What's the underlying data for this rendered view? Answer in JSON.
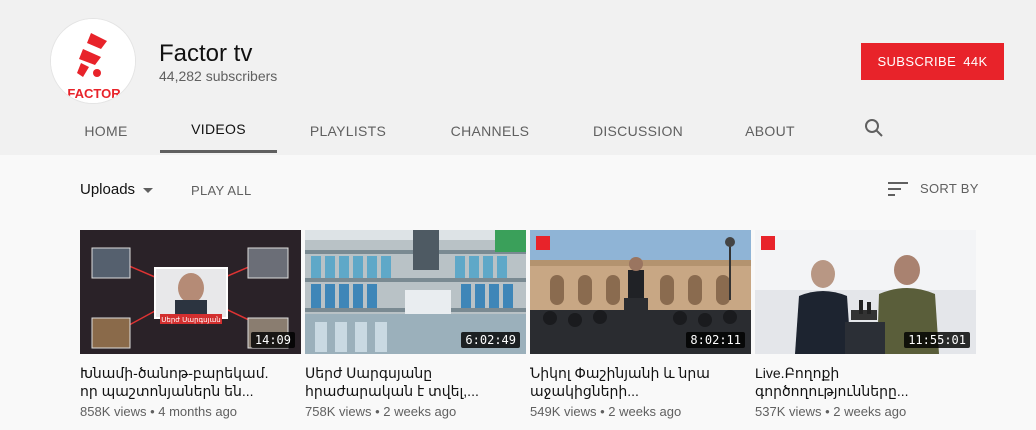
{
  "channel": {
    "name": "Factor tv",
    "subscribers": "44,282 subscribers",
    "avatar_text": "FACTOR",
    "brand_color": "#e8232a"
  },
  "subscribe": {
    "label": "SUBSCRIBE",
    "count": "44K"
  },
  "tabs": [
    {
      "label": "HOME"
    },
    {
      "label": "VIDEOS",
      "active": true
    },
    {
      "label": "PLAYLISTS"
    },
    {
      "label": "CHANNELS"
    },
    {
      "label": "DISCUSSION"
    },
    {
      "label": "ABOUT"
    }
  ],
  "search_icon": "search-icon",
  "toolbar": {
    "uploads_label": "Uploads",
    "play_all_label": "PLAY ALL",
    "sort_label": "SORT BY",
    "sort_icon": "sort-icon"
  },
  "videos": [
    {
      "title_line1": "Խնամի-ծանոթ-բարեկամ.",
      "title_line2": "որ պաշտոնյաներն են...",
      "meta": "858K views • 4 months ago",
      "duration": "14:09",
      "thumb_label": "Սերժ Սարգսյան"
    },
    {
      "title_line1": "Սերժ Սարգսյանը",
      "title_line2": "հրաժարական է տվել,...",
      "meta": "758K views • 2 weeks ago",
      "duration": "6:02:49"
    },
    {
      "title_line1": "Նիկոլ Փաշինյանի և նրա",
      "title_line2": "աջակիցների...",
      "meta": "549K views • 2 weeks ago",
      "duration": "8:02:11"
    },
    {
      "title_line1": "Live.Բողոքի",
      "title_line2": "գործողությունները...",
      "meta": "537K views • 2 weeks ago",
      "duration": "11:55:01"
    }
  ]
}
